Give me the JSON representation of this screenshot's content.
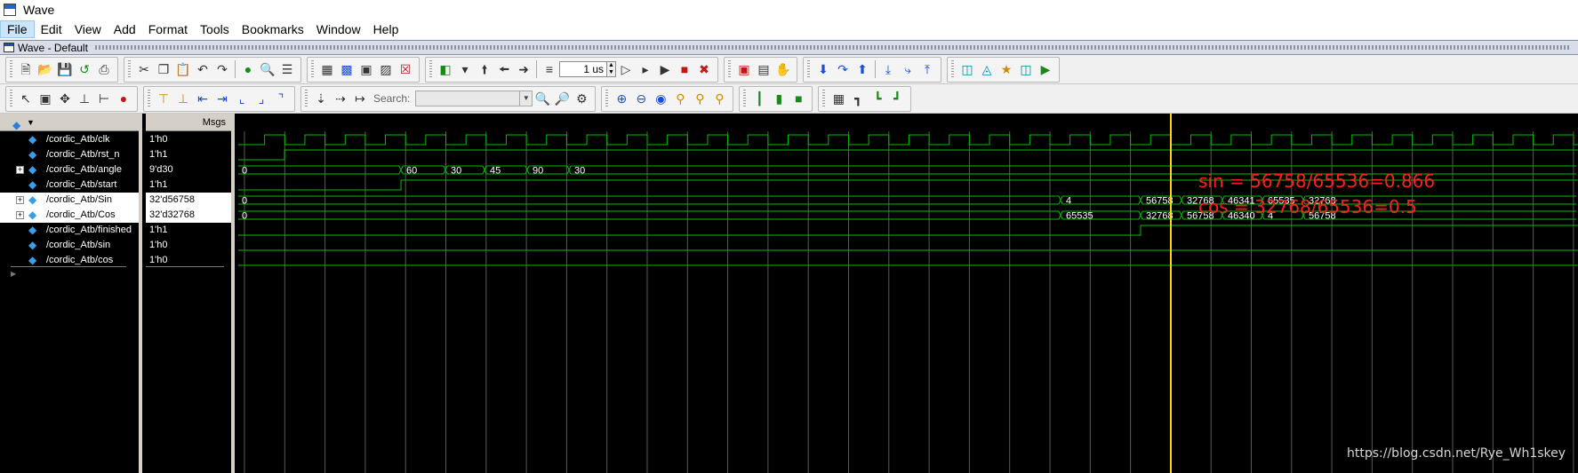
{
  "window": {
    "title": "Wave"
  },
  "menu": [
    {
      "label": "File",
      "active": true
    },
    {
      "label": "Edit"
    },
    {
      "label": "View"
    },
    {
      "label": "Add"
    },
    {
      "label": "Format"
    },
    {
      "label": "Tools"
    },
    {
      "label": "Bookmarks"
    },
    {
      "label": "Window"
    },
    {
      "label": "Help"
    }
  ],
  "wave_window": {
    "title": "Wave - Default"
  },
  "toolbar": {
    "time_value": "1 us",
    "search_label": "Search:",
    "search_value": ""
  },
  "panes": {
    "values_header": "Msgs"
  },
  "signals": [
    {
      "name": "/cordic_Atb/clk",
      "value": "1'h0",
      "expandable": false
    },
    {
      "name": "/cordic_Atb/rst_n",
      "value": "1'h1",
      "expandable": false
    },
    {
      "name": "/cordic_Atb/angle",
      "value": "9'd30",
      "expandable": true
    },
    {
      "name": "/cordic_Atb/start",
      "value": "1'h1",
      "expandable": false
    },
    {
      "name": "/cordic_Atb/Sin",
      "value": "32'd56758",
      "expandable": true,
      "selected": true
    },
    {
      "name": "/cordic_Atb/Cos",
      "value": "32'd32768",
      "expandable": true,
      "selected": true
    },
    {
      "name": "/cordic_Atb/finished",
      "value": "1'h1",
      "expandable": false
    },
    {
      "name": "/cordic_Atb/sin",
      "value": "1'h0",
      "expandable": false
    },
    {
      "name": "/cordic_Atb/cos",
      "value": "1'h0",
      "expandable": false
    }
  ],
  "bus_values": {
    "angle": [
      "0",
      "60",
      "30",
      "45",
      "90",
      "30"
    ],
    "sin": [
      "0",
      "4",
      "56758",
      "32768",
      "46341",
      "65535",
      "32768"
    ],
    "cos": [
      "0",
      "65535",
      "32768",
      "56758",
      "46340",
      "4",
      "56758"
    ]
  },
  "annotations": [
    "sin = 56758/65536=0.866",
    "cos = 32768/65536=0.5"
  ],
  "watermark": "https://blog.csdn.net/Rye_Wh1skey",
  "colors": {
    "wave": "#00c000",
    "cursor": "#ffd700",
    "annotation": "#ff1e1e",
    "grid": "#5a5a5a",
    "background": "#000000"
  }
}
